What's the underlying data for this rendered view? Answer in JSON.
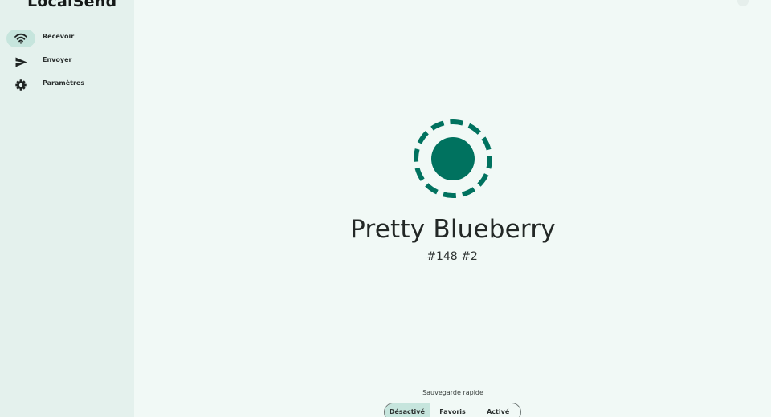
{
  "app": {
    "title": "LocalSend"
  },
  "sidebar": {
    "items": [
      {
        "label": "Recevoir",
        "icon": "wifi-icon",
        "active": true
      },
      {
        "label": "Envoyer",
        "icon": "send-icon",
        "active": false
      },
      {
        "label": "Paramètres",
        "icon": "gear-icon",
        "active": false
      }
    ]
  },
  "main": {
    "device_name": "Pretty Blueberry",
    "device_ids": "#148 #2",
    "quick_save": {
      "label": "Sauvegarde rapide",
      "options": [
        "Désactivé",
        "Favoris",
        "Activé"
      ],
      "selected": "Désactivé"
    }
  },
  "colors": {
    "accent": "#00725f",
    "sidebar_bg": "#e4f1ed",
    "main_bg": "#f1f9f6",
    "selected_pill": "#c6e5dd"
  }
}
